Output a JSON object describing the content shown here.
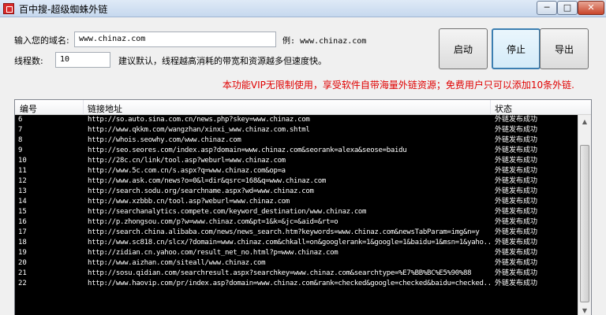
{
  "window": {
    "title": "百中搜-超级蜘蛛外链",
    "min_label": "─",
    "max_label": "□",
    "close_label": "✕"
  },
  "form": {
    "domain_label": "输入您的域名:",
    "domain_value": "www.chinaz.com",
    "example_text": "例: www.chinaz.com",
    "threads_label": "线程数:",
    "threads_value": "10",
    "threads_hint": "建议默认，线程越高消耗的带宽和资源越多但速度快。"
  },
  "buttons": {
    "start": "启动",
    "stop": "停止",
    "export": "导出"
  },
  "notice": "本功能VIP无限制使用，享受软件自带海量外链资源；免费用户只可以添加10条外链.",
  "table": {
    "headers": {
      "id": "编号",
      "url": "链接地址",
      "status": "状态"
    },
    "rows": [
      {
        "id": "6",
        "url": "http://so.auto.sina.com.cn/news.php?skey=www.chinaz.com",
        "status": "外链发布成功"
      },
      {
        "id": "7",
        "url": "http://www.qkkm.com/wangzhan/xinxi_www.chinaz.com.shtml",
        "status": "外链发布成功"
      },
      {
        "id": "8",
        "url": "http://whois.seowhy.com/www.chinaz.com",
        "status": "外链发布成功"
      },
      {
        "id": "9",
        "url": "http://seo.seores.com/index.asp?domain=www.chinaz.com&seorank=alexa&seose=baidu",
        "status": "外链发布成功"
      },
      {
        "id": "10",
        "url": "http://28c.cn/link/tool.asp?weburl=www.chinaz.com",
        "status": "外链发布成功"
      },
      {
        "id": "11",
        "url": "http://www.5c.com.cn/s.aspx?q=www.chinaz.com&op=a",
        "status": "外链发布成功"
      },
      {
        "id": "12",
        "url": "http://www.ask.com/news?o=0&l=dir&qsrc=168&q=www.chinaz.com",
        "status": "外链发布成功"
      },
      {
        "id": "13",
        "url": "http://search.sodu.org/searchname.aspx?wd=www.chinaz.com",
        "status": "外链发布成功"
      },
      {
        "id": "14",
        "url": "http://www.xzbbb.cn/tool.asp?weburl=www.chinaz.com",
        "status": "外链发布成功"
      },
      {
        "id": "15",
        "url": "http://searchanalytics.compete.com/keyword_destination/www.chinaz.com",
        "status": "外链发布成功"
      },
      {
        "id": "16",
        "url": "http://p.zhongsou.com/p?w=www.chinaz.com&pt=1&k=&jc=&aid=&rt=o",
        "status": "外链发布成功"
      },
      {
        "id": "17",
        "url": "http://search.china.alibaba.com/news/news_search.htm?keywords=www.chinaz.com&newsTabParam=img&n=y",
        "status": "外链发布成功"
      },
      {
        "id": "18",
        "url": "http://www.sc818.cn/slcx/?domain=www.chinaz.com&chkall=on&googlerank=1&google=1&baidu=1&msn=1&yaho...",
        "status": "外链发布成功"
      },
      {
        "id": "19",
        "url": "http://zidian.cn.yahoo.com/result_net_no.html?p=www.chinaz.com",
        "status": "外链发布成功"
      },
      {
        "id": "20",
        "url": "http://www.aizhan.com/siteall/www.chinaz.com",
        "status": "外链发布成功"
      },
      {
        "id": "21",
        "url": "http://sosu.qidian.com/searchresult.aspx?searchkey=www.chinaz.com&searchtype=%E7%BB%BC%E5%90%88",
        "status": "外链发布成功"
      },
      {
        "id": "22",
        "url": "http://www.haovip.com/pr/index.asp?domain=www.chinaz.com&rank=checked&google=checked&baidu=checked...",
        "status": "外链发布成功"
      }
    ]
  },
  "scrollbar": {
    "up": "▲",
    "down": "▼"
  }
}
